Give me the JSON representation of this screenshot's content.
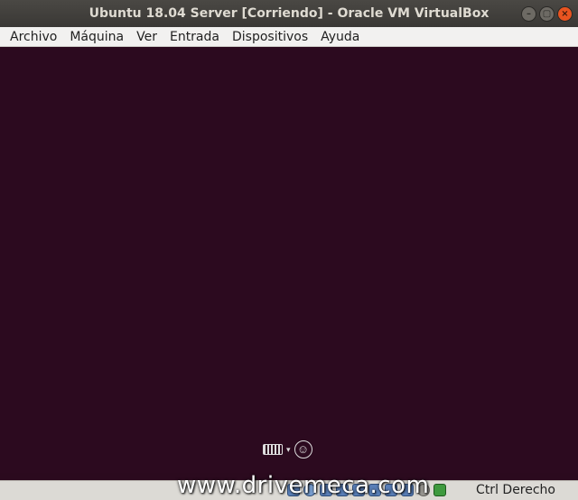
{
  "window": {
    "title": "Ubuntu 18.04 Server [Corriendo] - Oracle VM VirtualBox",
    "buttons": {
      "minimize": "–",
      "maximize": "▢",
      "close": "×"
    }
  },
  "menubar": {
    "items": [
      "Archivo",
      "Máquina",
      "Ver",
      "Entrada",
      "Dispositivos",
      "Ayuda"
    ]
  },
  "vm_screen": {
    "background": "#2c0a1f"
  },
  "accessibility": {
    "icons": [
      "keyboard-icon",
      "arrow-icon",
      "accessibility-icon"
    ],
    "arrow_glyph": "▾",
    "access_glyph": "☺"
  },
  "statusbar": {
    "icons": [
      "hard-disk-icon",
      "optical-drive-icon",
      "audio-icon",
      "network-icon",
      "usb-icon",
      "shared-folders-icon",
      "display-icon",
      "video-capture-icon",
      "virtualization-icon",
      "host-key-arrow-icon"
    ],
    "host_key": "Ctrl Derecho"
  },
  "watermark": "www.drivemeca.com"
}
